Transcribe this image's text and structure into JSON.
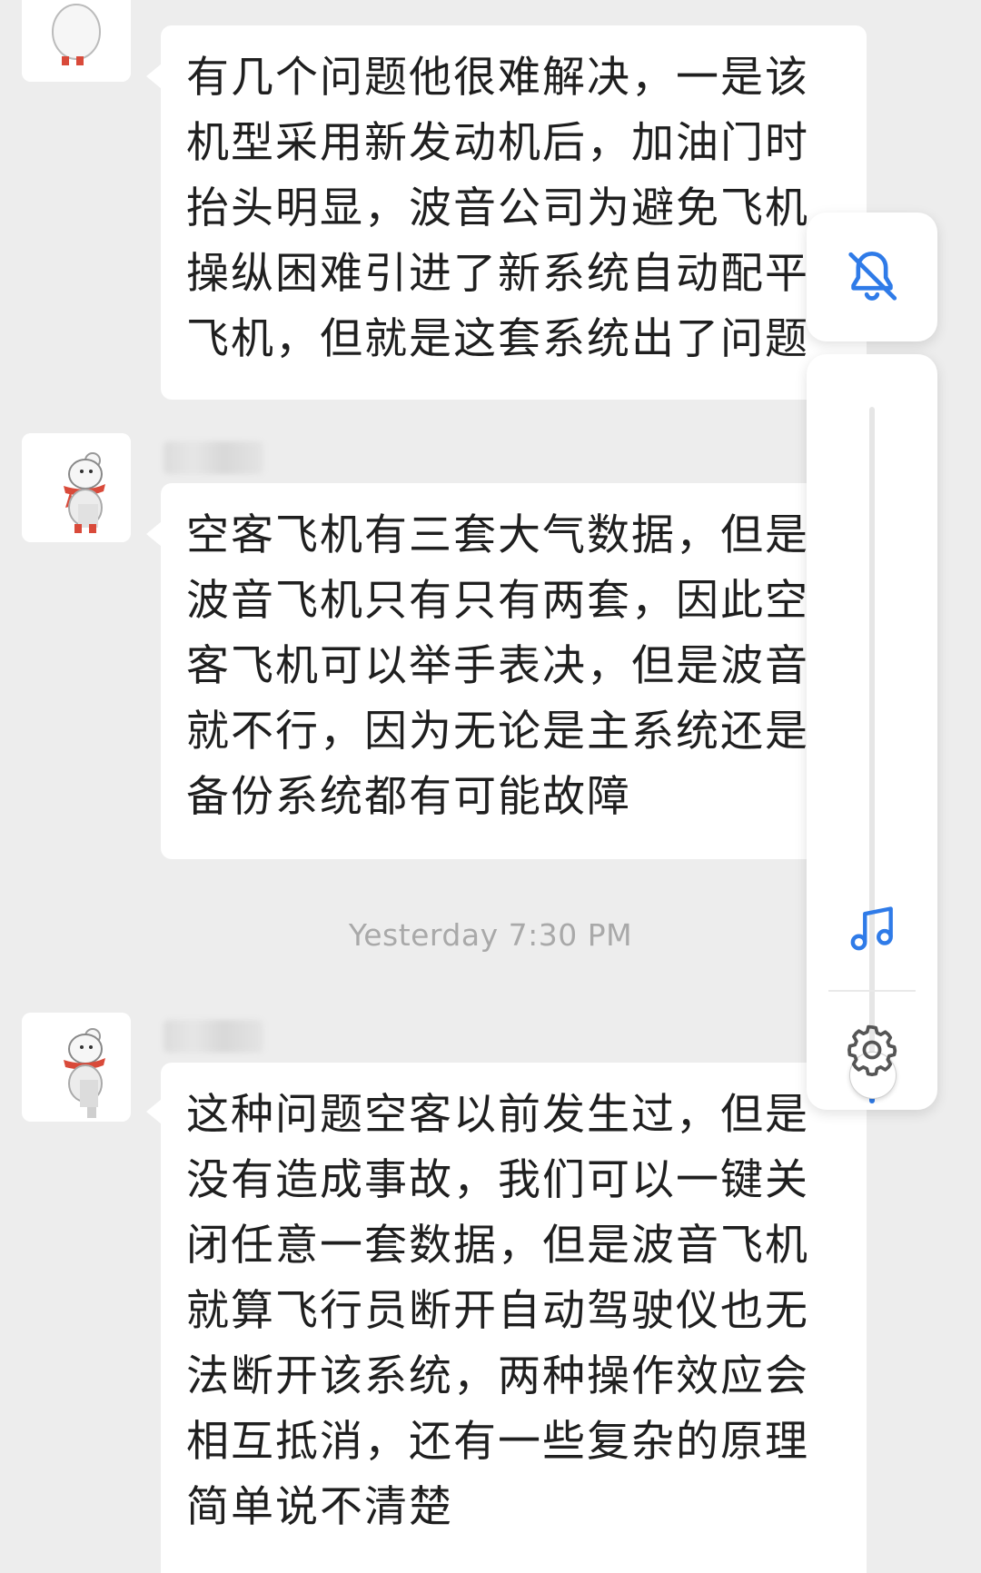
{
  "messages": [
    {
      "text": "有几个问题他很难解决，一是该机型采用新发动机后，加油门时抬头明显，波音公司为避免飞机操纵困难引进了新系统自动配平飞机，但就是这套系统出了问题"
    },
    {
      "text": "空客飞机有三套大气数据，但是波音飞机只有只有两套，因此空客飞机可以举手表决，但是波音就不行，因为无论是主系统还是备份系统都有可能故障"
    },
    {
      "text": "这种问题空客以前发生过，但是没有造成事故，我们可以一键关闭任意一套数据，但是波音飞机就算飞行员断开自动驾驶仪也无法断开该系统，两种操作效应会相互抵消，还有一些复杂的原理简单说不清楚"
    }
  ],
  "timestamp": "Yesterday 7:30 PM",
  "volume_panel": {
    "level": 0.08,
    "icons": {
      "mute": "bell-off-icon",
      "media": "music-note-icon",
      "settings": "gear-icon"
    },
    "accent": "#2f7be8"
  },
  "colors": {
    "background": "#ededed",
    "bubble": "#ffffff",
    "text": "#1f1f1f",
    "timestamp": "#a9a9a9"
  }
}
